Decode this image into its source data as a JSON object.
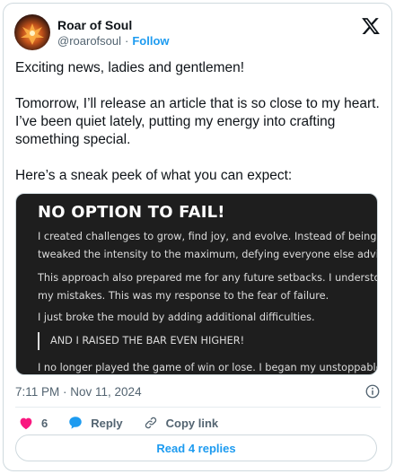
{
  "author": {
    "display_name": "Roar of Soul",
    "handle": "@roarofsoul",
    "separator": "·",
    "follow_label": "Follow"
  },
  "tweet": {
    "paragraphs": [
      "Exciting news, ladies and gentlemen!",
      "Tomorrow, I’ll release an article that is so close to my heart. I’ve been quiet lately, putting my energy into crafting something special.",
      "Here’s a sneak peek of what you can expect:"
    ]
  },
  "media": {
    "title": "NO OPTION TO FAIL!",
    "lines": [
      "I created challenges to grow, find joy, and evolve. Instead of being c",
      "tweaked the intensity to the maximum, defying everyone else advice",
      "This approach also prepared me for any future setbacks. I understo",
      "my mistakes. This was my response to the fear of failure.",
      "I just broke the mould by adding additional difficulties."
    ],
    "quote": "AND I RAISED THE BAR EVEN HIGHER!",
    "last_line": "I no longer played the game of win or lose. I began my unstoppable"
  },
  "meta": {
    "timestamp": "7:11 PM · Nov 11, 2024"
  },
  "actions": {
    "like_count": "6",
    "reply_label": "Reply",
    "copy_label": "Copy link",
    "like_color": "#f91880",
    "accent_color": "#1d9bf0"
  },
  "footer": {
    "read_replies_label": "Read 4 replies"
  },
  "icons": [
    "avatar-phoenix",
    "x-logo-icon",
    "info-icon",
    "heart-icon",
    "reply-bubble-icon",
    "link-icon"
  ]
}
